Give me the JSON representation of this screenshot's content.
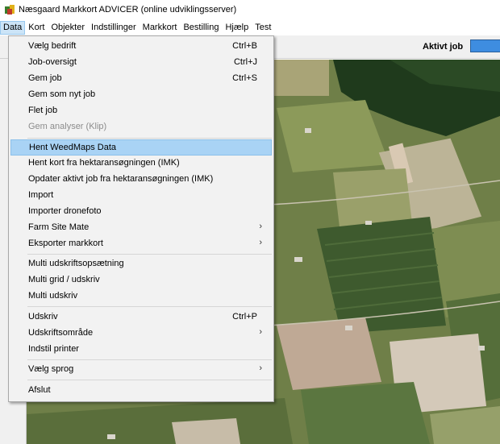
{
  "window": {
    "title": "Næsgaard Markkort ADVICER (online udviklingsserver)"
  },
  "menubar": {
    "items": [
      "Data",
      "Kort",
      "Objekter",
      "Indstillinger",
      "Markkort",
      "Bestilling",
      "Hjælp",
      "Test"
    ],
    "open_index": 0
  },
  "toolbar": {
    "active_job_label": "Aktivt job"
  },
  "data_menu": {
    "items": [
      {
        "label": "Vælg bedrift",
        "shortcut": "Ctrl+B"
      },
      {
        "label": "Job-oversigt",
        "shortcut": "Ctrl+J"
      },
      {
        "label": "Gem job",
        "shortcut": "Ctrl+S"
      },
      {
        "label": "Gem som nyt job",
        "shortcut": ""
      },
      {
        "label": "Flet job",
        "shortcut": ""
      },
      {
        "label": "Gem analyser (Klip)",
        "shortcut": "",
        "disabled": true
      },
      {
        "label": "Hent WeedMaps Data",
        "shortcut": "",
        "highlighted": true
      },
      {
        "label": "Hent kort fra hektaransøgningen (IMK)",
        "shortcut": ""
      },
      {
        "label": "Opdater aktivt job fra hektaransøgningen (IMK)",
        "shortcut": ""
      },
      {
        "label": "Import",
        "shortcut": ""
      },
      {
        "label": "Importer dronefoto",
        "shortcut": ""
      },
      {
        "label": "Farm Site Mate",
        "shortcut": "",
        "submenu": true
      },
      {
        "label": "Eksporter markkort",
        "shortcut": "",
        "submenu": true
      },
      {
        "label": "Multi udskriftsopsætning",
        "shortcut": ""
      },
      {
        "label": "Multi grid / udskriv",
        "shortcut": ""
      },
      {
        "label": "Multi udskriv",
        "shortcut": ""
      },
      {
        "label": "Udskriv",
        "shortcut": "Ctrl+P"
      },
      {
        "label": "Udskriftsområde",
        "shortcut": "",
        "submenu": true
      },
      {
        "label": "Indstil printer",
        "shortcut": ""
      },
      {
        "label": "Vælg sprog",
        "shortcut": "",
        "submenu": true
      },
      {
        "label": "Afslut",
        "shortcut": ""
      }
    ],
    "submenu_glyph": "›"
  },
  "colors": {
    "menu_highlight": "#a9d3f5",
    "active_job_field": "#3e8de0"
  }
}
